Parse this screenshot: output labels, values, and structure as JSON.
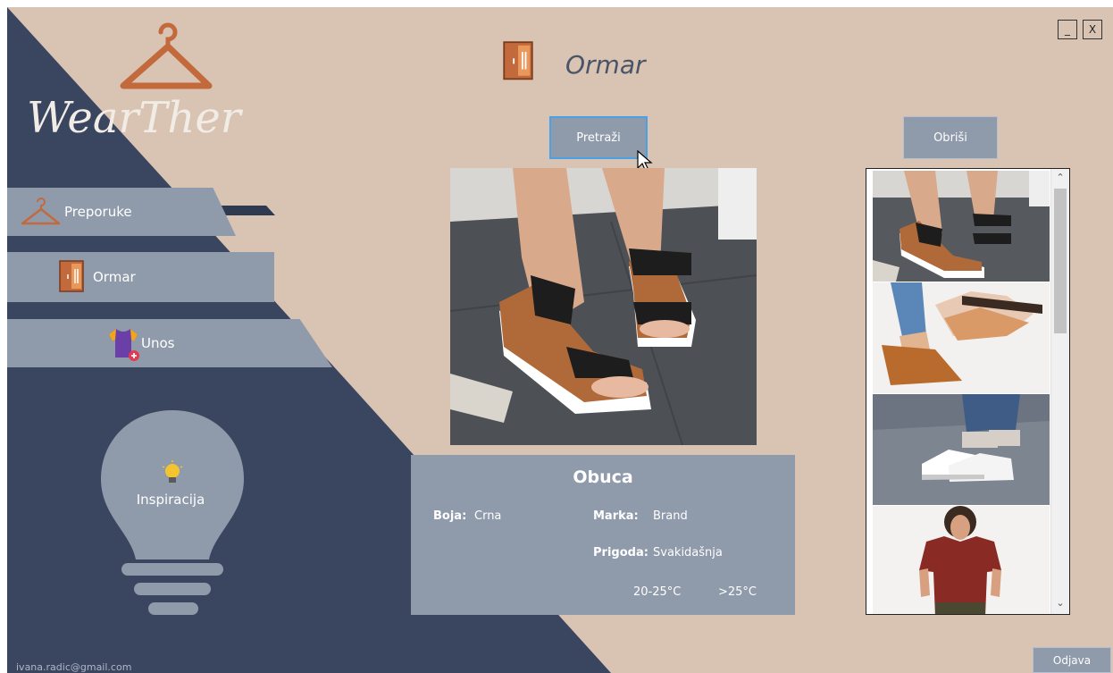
{
  "app": {
    "logo_text": "WearTher",
    "user_email": "ivana.radic@gmail.com"
  },
  "window": {
    "minimize_label": "_",
    "close_label": "X"
  },
  "header": {
    "title": "Ormar",
    "icon": "wardrobe-icon"
  },
  "sidebar": {
    "items": [
      {
        "label": "Preporuke",
        "icon": "hanger-icon"
      },
      {
        "label": "Ormar",
        "icon": "wardrobe-icon"
      },
      {
        "label": "Unos",
        "icon": "shirt-add-icon"
      }
    ],
    "inspiration_label": "Inspiracija"
  },
  "toolbar": {
    "search_label": "Pretraži",
    "delete_label": "Obriši"
  },
  "item": {
    "name": "Obuca",
    "color_label": "Boja:",
    "color_value": "Crna",
    "brand_label": "Marka:",
    "brand_value": "Brand",
    "occasion_label": "Prigoda:",
    "occasion_value": "Svakidašnja",
    "temp_range_1": "20-25°C",
    "temp_range_2": ">25°C"
  },
  "logout_label": "Odjava",
  "colors": {
    "navy": "#3a4560",
    "beige": "#d9c3b2",
    "panel": "#8f9aab",
    "accent_copper": "#c36a3c"
  }
}
